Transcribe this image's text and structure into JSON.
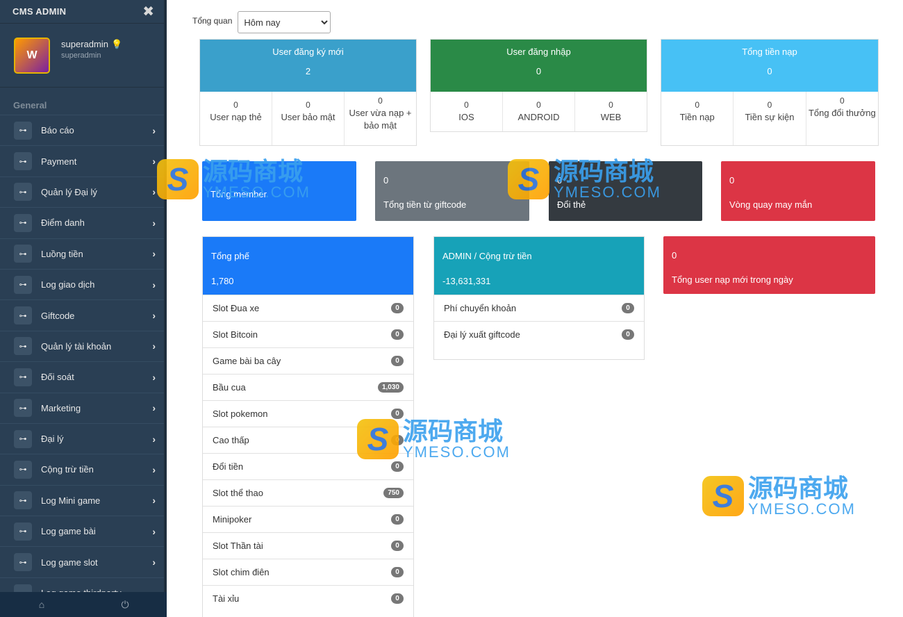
{
  "sidebar": {
    "title": "CMS ADMIN",
    "close_icon": "✖",
    "avatar_text": "W",
    "username": "superadmin",
    "bulb": "💡",
    "role": "superadmin",
    "section": "General",
    "items": [
      {
        "label": "Báo cáo"
      },
      {
        "label": "Payment"
      },
      {
        "label": "Quản lý Đại lý"
      },
      {
        "label": "Điểm danh"
      },
      {
        "label": "Luồng tiền"
      },
      {
        "label": "Log giao dịch"
      },
      {
        "label": "Giftcode"
      },
      {
        "label": "Quản lý tài khoản"
      },
      {
        "label": "Đối soát"
      },
      {
        "label": "Marketing"
      },
      {
        "label": "Đại lý"
      },
      {
        "label": "Cộng trừ tiền"
      },
      {
        "label": "Log Mini game"
      },
      {
        "label": "Log game bài"
      },
      {
        "label": "Log game slot"
      },
      {
        "label": "Log game thirdparty"
      }
    ],
    "footer_home": "⌂",
    "footer_power": "⏻"
  },
  "filter": {
    "label": "Tổng quan",
    "selected": "Hôm nay"
  },
  "stats": [
    {
      "title": "User đăng ký mới",
      "value": "2",
      "color": "#3aa0cb",
      "cells": [
        {
          "num": "0",
          "label": "User nạp thẻ"
        },
        {
          "num": "0",
          "label": "User bảo mật"
        },
        {
          "num": "0",
          "label": "User vừa nạp + bảo mật"
        }
      ]
    },
    {
      "title": "User đăng nhập",
      "value": "0",
      "color": "#2a8a47",
      "cells": [
        {
          "num": "0",
          "label": "IOS"
        },
        {
          "num": "0",
          "label": "ANDROID"
        },
        {
          "num": "0",
          "label": "WEB"
        }
      ]
    },
    {
      "title": "Tổng tiền nạp",
      "value": "0",
      "color": "#47c1f5",
      "cells": [
        {
          "num": "0",
          "label": "Tiền nạp"
        },
        {
          "num": "0",
          "label": "Tiền sự kiện"
        },
        {
          "num": "0",
          "label": "Tổng đổi thưởng"
        }
      ]
    }
  ],
  "tiles": [
    {
      "value": "",
      "label": "Tổng member",
      "color": "#1a7af8"
    },
    {
      "value": "0",
      "label": "Tổng tiền từ giftcode",
      "color": "#6c757d"
    },
    {
      "value": "0",
      "label": "Đổi thẻ",
      "color": "#343a40"
    },
    {
      "value": "0",
      "label": "Vòng quay may mắn",
      "color": "#dc3545"
    }
  ],
  "fee_panel": {
    "title": "Tổng phế",
    "value": "1,780",
    "color": "#1a7af8",
    "items": [
      {
        "label": "Slot Đua xe",
        "count": "0"
      },
      {
        "label": "Slot Bitcoin",
        "count": "0"
      },
      {
        "label": "Game bài ba cây",
        "count": "0"
      },
      {
        "label": "Bầu cua",
        "count": "1,030"
      },
      {
        "label": "Slot pokemon",
        "count": "0"
      },
      {
        "label": "Cao thấp",
        "count": "0"
      },
      {
        "label": "Đổi tiền",
        "count": "0"
      },
      {
        "label": "Slot thể thao",
        "count": "750"
      },
      {
        "label": "Minipoker",
        "count": "0"
      },
      {
        "label": "Slot Thần tài",
        "count": "0"
      },
      {
        "label": "Slot chim điên",
        "count": "0"
      },
      {
        "label": "Tài xỉu",
        "count": "0"
      }
    ]
  },
  "admin_panel": {
    "title": "ADMIN / Cộng trừ tiền",
    "value": "-13,631,331",
    "color": "#17a2b8",
    "items": [
      {
        "label": "Phí chuyển khoản",
        "count": "0"
      },
      {
        "label": "Đại lý xuất giftcode",
        "count": "0"
      }
    ]
  },
  "new_user_tile": {
    "value": "0",
    "label": "Tổng user nạp mới trong ngày",
    "color": "#dc3545"
  },
  "watermark": {
    "logo": "S",
    "cn": "源码商城",
    "en": "YMESO.COM"
  }
}
